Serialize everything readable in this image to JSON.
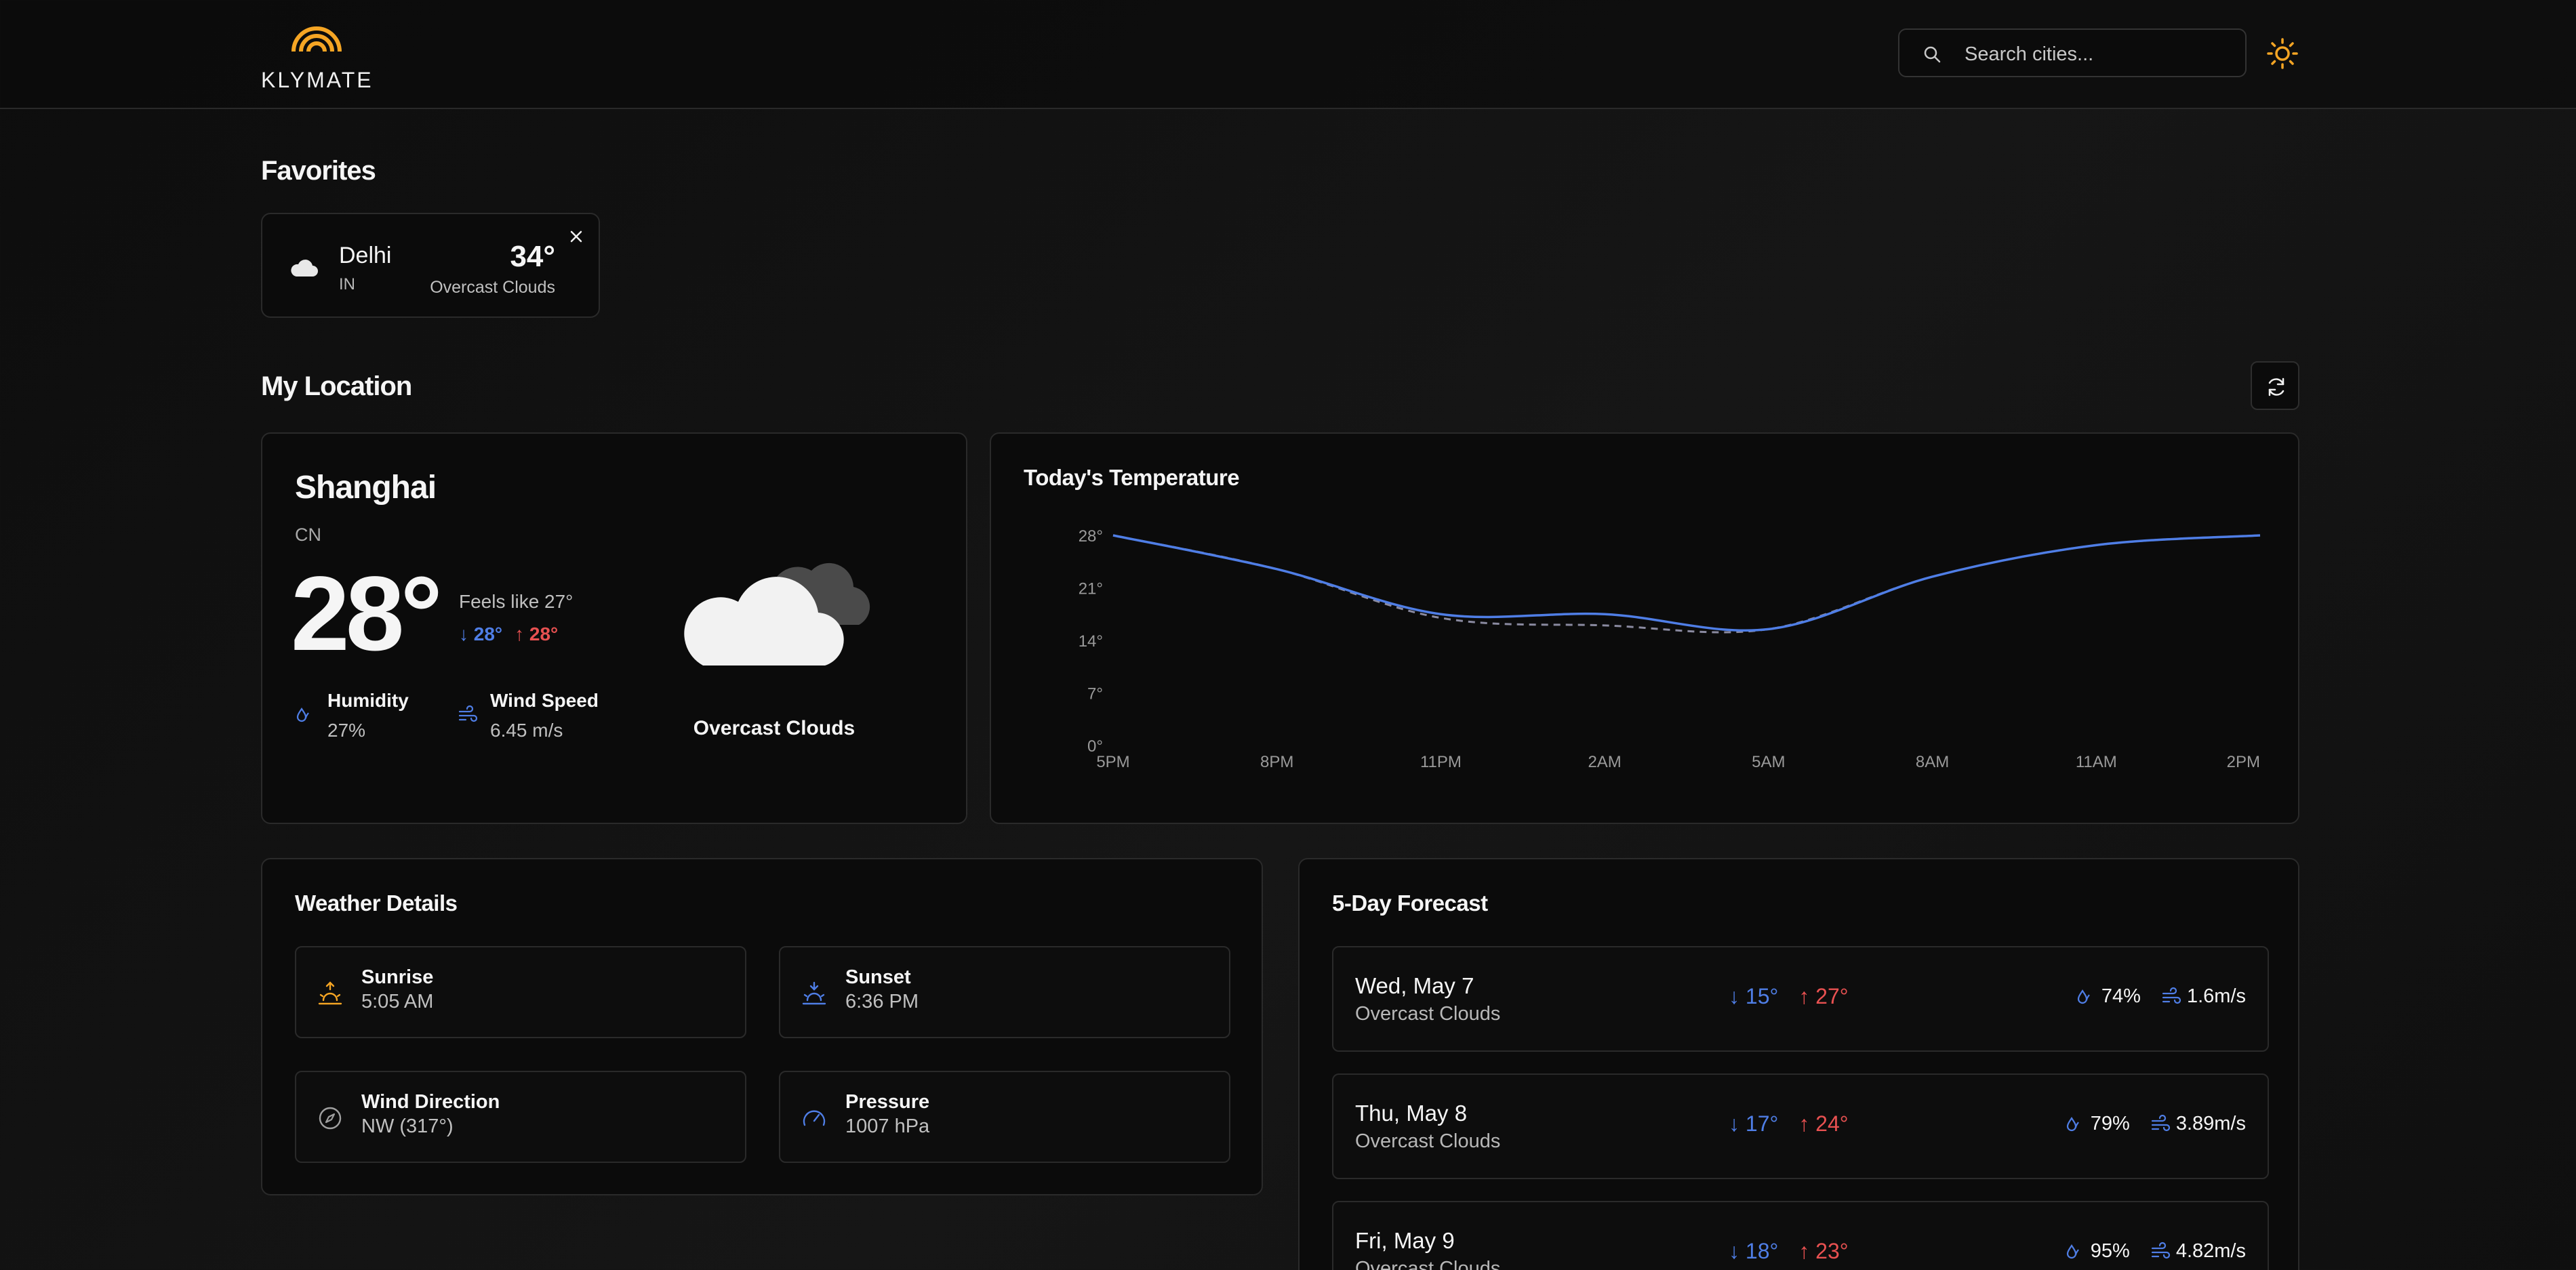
{
  "app": {
    "name": "KLYMATE"
  },
  "search": {
    "placeholder": "Search cities..."
  },
  "favorites": {
    "title": "Favorites",
    "items": [
      {
        "city": "Delhi",
        "country": "IN",
        "temp": "34°",
        "condition": "Overcast Clouds"
      }
    ]
  },
  "my_location": {
    "title": "My Location",
    "city": "Shanghai",
    "country": "CN",
    "temp": "28°",
    "feels_like": "Feels like 27°",
    "min": "28°",
    "max": "28°",
    "humidity_label": "Humidity",
    "humidity_value": "27%",
    "wind_label": "Wind Speed",
    "wind_value": "6.45 m/s",
    "condition": "Overcast Clouds"
  },
  "todays_temperature": {
    "title": "Today's Temperature",
    "chart_data": {
      "type": "line",
      "x": [
        "5PM",
        "8PM",
        "11PM",
        "2AM",
        "5AM",
        "8AM",
        "11AM",
        "2PM"
      ],
      "y_ticks": [
        "0°",
        "7°",
        "14°",
        "21°",
        "28°"
      ],
      "ylim": [
        0,
        28
      ],
      "series": [
        {
          "values": [
            28,
            23.5,
            17.5,
            17.5,
            15.5,
            22.5,
            26.7,
            28
          ],
          "style": "solid",
          "color": "#4f7ee6"
        },
        {
          "values": [
            28,
            23.5,
            17,
            16,
            15.5,
            22.5,
            26.7,
            28
          ],
          "style": "dashed",
          "color": "#8a8aa0"
        }
      ]
    }
  },
  "weather_details": {
    "title": "Weather Details",
    "tiles": [
      {
        "label": "Sunrise",
        "value": "5:05 AM",
        "icon": "sunrise-icon"
      },
      {
        "label": "Sunset",
        "value": "6:36 PM",
        "icon": "sunset-icon"
      },
      {
        "label": "Wind Direction",
        "value": "NW (317°)",
        "icon": "compass-icon"
      },
      {
        "label": "Pressure",
        "value": "1007 hPa",
        "icon": "gauge-icon"
      }
    ]
  },
  "forecast": {
    "title": "5-Day Forecast",
    "days": [
      {
        "day": "Wed, May 7",
        "condition": "Overcast Clouds",
        "min": "15°",
        "max": "27°",
        "humidity": "74%",
        "wind": "1.6m/s"
      },
      {
        "day": "Thu, May 8",
        "condition": "Overcast Clouds",
        "min": "17°",
        "max": "24°",
        "humidity": "79%",
        "wind": "3.89m/s"
      },
      {
        "day": "Fri, May 9",
        "condition": "Overcast Clouds",
        "min": "18°",
        "max": "23°",
        "humidity": "95%",
        "wind": "4.82m/s"
      }
    ]
  },
  "colors": {
    "accent": "#f5a524",
    "min_temp": "#4f7ee6",
    "max_temp": "#e85151"
  }
}
